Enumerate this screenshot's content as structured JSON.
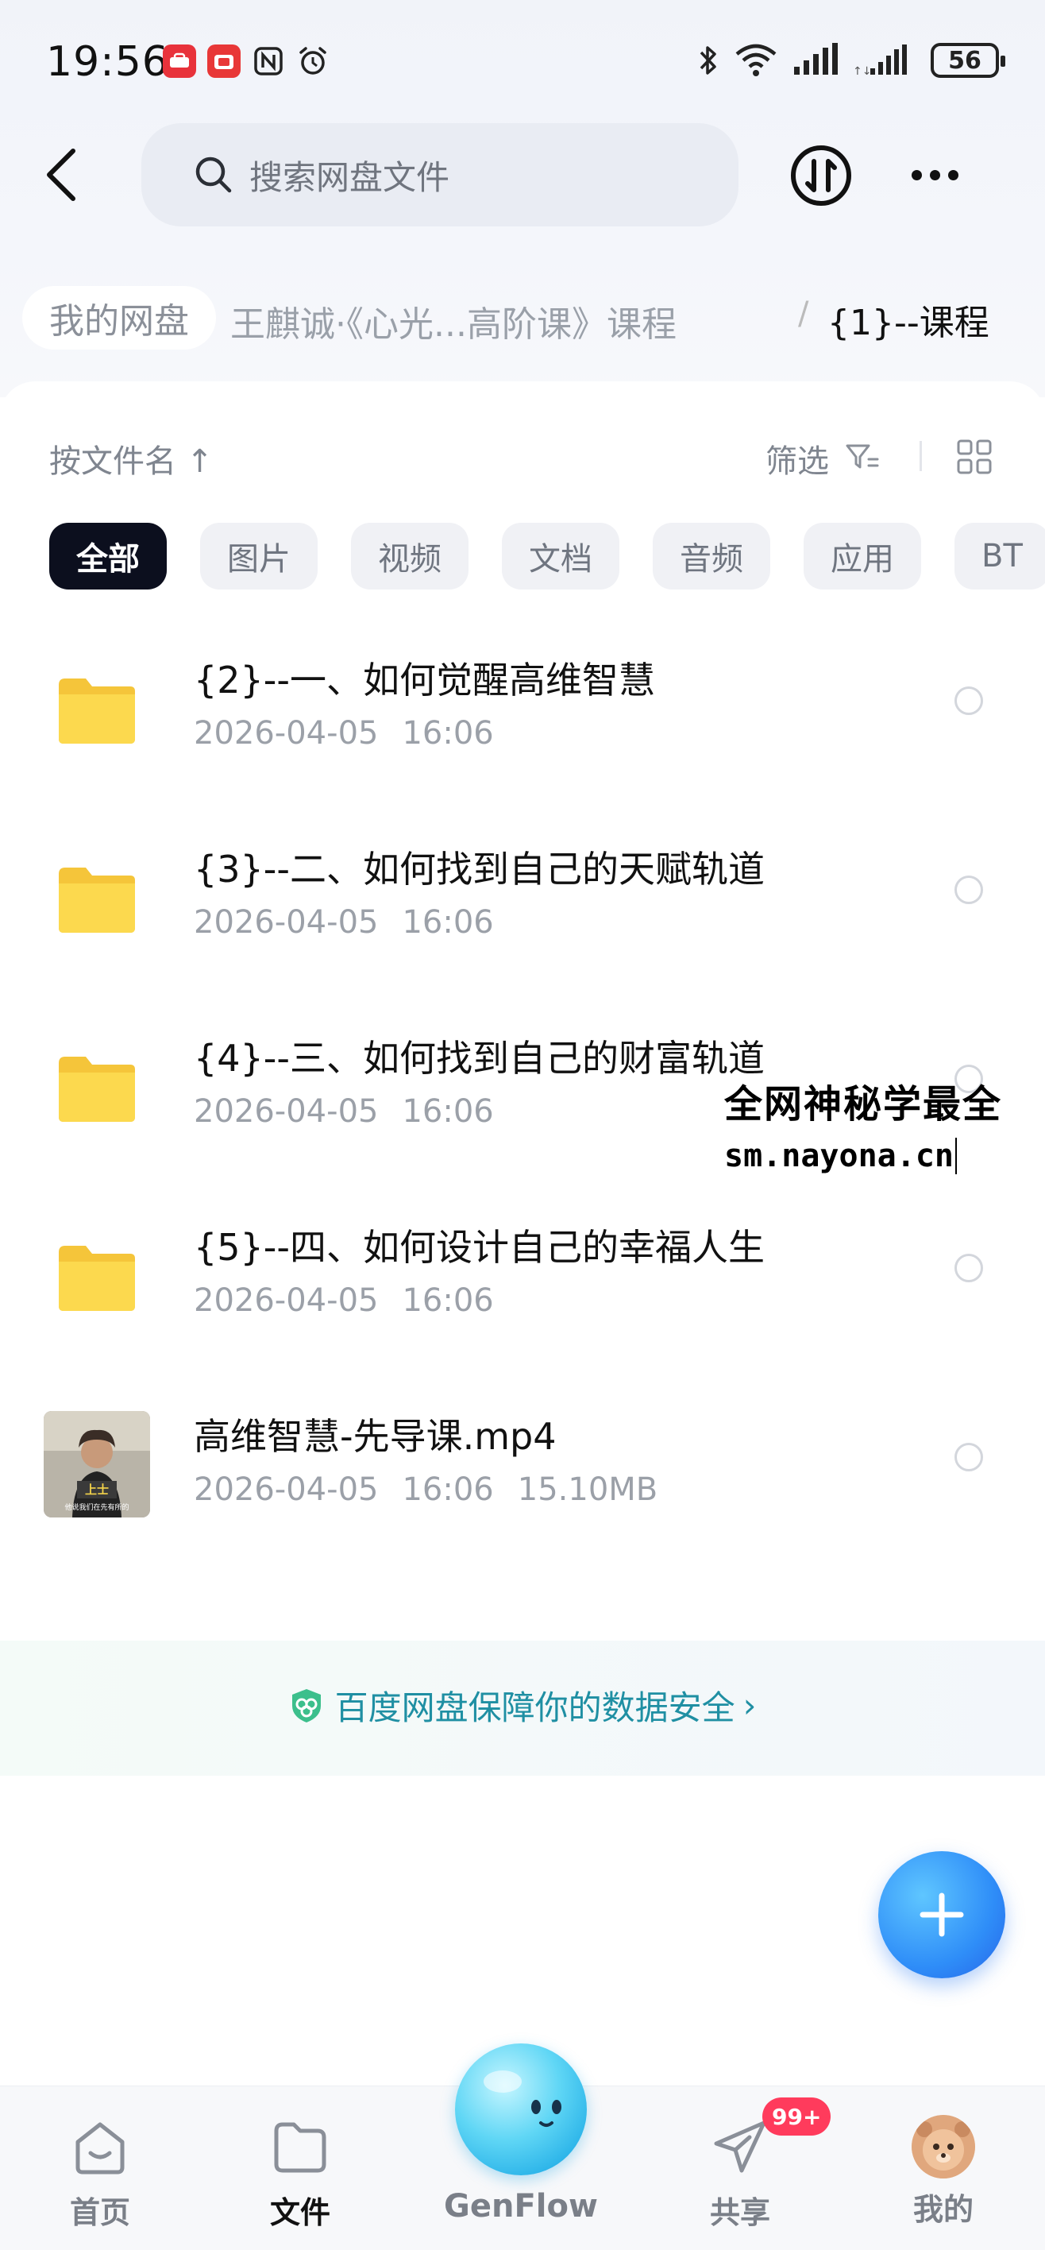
{
  "status_bar": {
    "time": "19:56",
    "battery": "56"
  },
  "header": {
    "search_placeholder": "搜索网盘文件"
  },
  "breadcrumb": {
    "root": "我的网盘",
    "middle": "王麒诚·《心光...高阶课》课程",
    "separator": "/",
    "current": "{1}--课程"
  },
  "toolbar": {
    "sort_label": "按文件名 ↑",
    "filter_label": "筛选"
  },
  "chips": [
    "全部",
    "图片",
    "视频",
    "文档",
    "音频",
    "应用",
    "BT"
  ],
  "files": [
    {
      "name": "{2}--一、如何觉醒高维智慧",
      "date": "2026-04-05",
      "time": "16:06",
      "size": "",
      "type": "folder"
    },
    {
      "name": "{3}--二、如何找到自己的天赋轨道",
      "date": "2026-04-05",
      "time": "16:06",
      "size": "",
      "type": "folder"
    },
    {
      "name": "{4}--三、如何找到自己的财富轨道",
      "date": "2026-04-05",
      "time": "16:06",
      "size": "",
      "type": "folder"
    },
    {
      "name": "{5}--四、如何设计自己的幸福人生",
      "date": "2026-04-05",
      "time": "16:06",
      "size": "",
      "type": "folder"
    },
    {
      "name": "高维智慧-先导课.mp4",
      "date": "2026-04-05",
      "time": "16:06",
      "size": "15.10MB",
      "type": "video"
    }
  ],
  "video_thumb_text": {
    "top": "上士",
    "bottom": "他说我们在先有所的"
  },
  "watermark": {
    "line1": "全网神秘学最全",
    "line2": "sm.nayona.cn"
  },
  "security_text": "百度网盘保障你的数据安全",
  "bottom_nav": {
    "home": "首页",
    "files": "文件",
    "genflow": "GenFlow",
    "share": "共享",
    "mine": "我的",
    "share_badge": "99+"
  },
  "colors": {
    "accent": "#2f8ef8",
    "active_chip": "#0c0f1e",
    "security_text": "#1f8fa3",
    "badge": "#ff3b5c"
  }
}
